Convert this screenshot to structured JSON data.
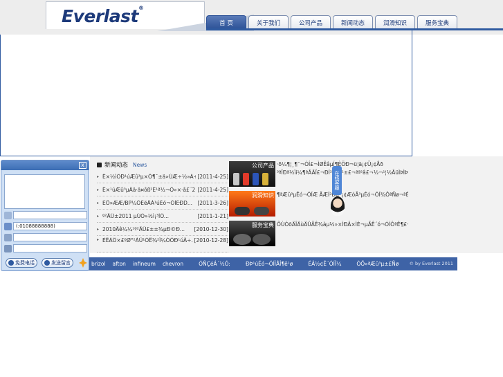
{
  "logo": {
    "text": "Everlast",
    "mark": "®"
  },
  "nav": {
    "items": [
      {
        "label": "首 页",
        "active": true,
        "width": 58
      },
      {
        "label": "关于我们",
        "active": false,
        "width": 58
      },
      {
        "label": "公司产品",
        "active": false,
        "width": 58
      },
      {
        "label": "新闻动态",
        "active": false,
        "width": 58
      },
      {
        "label": "润滑知识",
        "active": false,
        "width": 58
      },
      {
        "label": "服务宝典",
        "active": false,
        "width": 58
      }
    ]
  },
  "news": {
    "title": "新闻动态",
    "title_en": "News",
    "items": [
      {
        "text": "Ê×½ìÖÐ¹úÆû³µ×Ô¶¯±ä»ÙÆ÷½»Á÷...",
        "date": "[2011-4-25]"
      },
      {
        "text": "Ê×¹úÆû³µÂä·ä¤ôß²É¹ª½¬Ö»×·â£¨2...",
        "date": "[2011-4-25]"
      },
      {
        "text": "ÈÕ»ÆÆ/BP¼ÓÈëÃÀ¹úÉó¬ÓÍÉÐD...",
        "date": "[2011-3-26]"
      },
      {
        "text": "º²ÃÜ±2011 µÚÒ»½ì¡³ÌÖ...",
        "date": "[2011-1-21]"
      },
      {
        "text": "2010Äê¼¼¹º²ÄÛ£±±¾µÐ©Ð...",
        "date": "[2010-12-30]"
      },
      {
        "text": "ÈËÀÖ×£ºØ°²ÀÛ¹ÓË¾²Î¼ÓÖÐ¹úÂ÷...",
        "date": "[2010-12-28]"
      }
    ]
  },
  "products": [
    {
      "label": "公司产品",
      "desc_lines": [
        "·ð¼¶¦¸¶¯¬ÓÍ£¬ÌØÊâµÍ¶ÈÖÐ¬ü¦ä¡¢Ü¡¢Åð",
        "³ªÎÐª½ìì¼¶ªÂÄÏ£¬ÐÍ²ªßN¹±£¬ªª²â£¬½¬¹¦½ÂüÌÞÌÞµÄ¼ÝÈ»ÐÖ..."
      ]
    },
    {
      "label": "润滑知识",
      "desc_lines": [
        "¶ªÆû³µÊó¬ÓÍÆ ÃÆÍ²Ðµ¯¡¢ÆóÃ³µÉó¬ÓÍ¾ÔªÑø¬ªÉ¡±ÂàÑµ£"
      ]
    },
    {
      "label": "服务宝典",
      "desc_lines": [
        "ÕÙÓõÄÎÄùÄÛÃÊ¾àµ½»×ÌÐÂ×ÌÈ¬µÃÊ´ó¬ÓÍÔªÊ¶£¬º¹Ãù¹ã¾õÈÕ³µÄÆÆû³µÐÐÊ·ÎÊâ..."
      ]
    }
  ],
  "floating_tab": "在线客服",
  "footer": {
    "links": [
      "brizol",
      "afton",
      "infineum",
      "chevron"
    ],
    "links2": [
      "ÓÑÇéÁ´½Ó:",
      "ÐÞ¹úÉó¬ÓÍÍÅÎ¶ê¹ø",
      "ÉÂ½¢Ê´ÓÍÎ¼",
      "ÒÕ»ªÆû³µ±£Ñø"
    ],
    "copyright": "© by Everlast 2011"
  },
  "chat": {
    "close": "x",
    "phone_value": "(:01088888888)",
    "call_button": "免费电话",
    "message_button": "发送留言"
  },
  "colors": {
    "brand_blue": "#2f5aa0",
    "nav_active": "#2d5297",
    "footer_bg": "#3e63a6"
  }
}
